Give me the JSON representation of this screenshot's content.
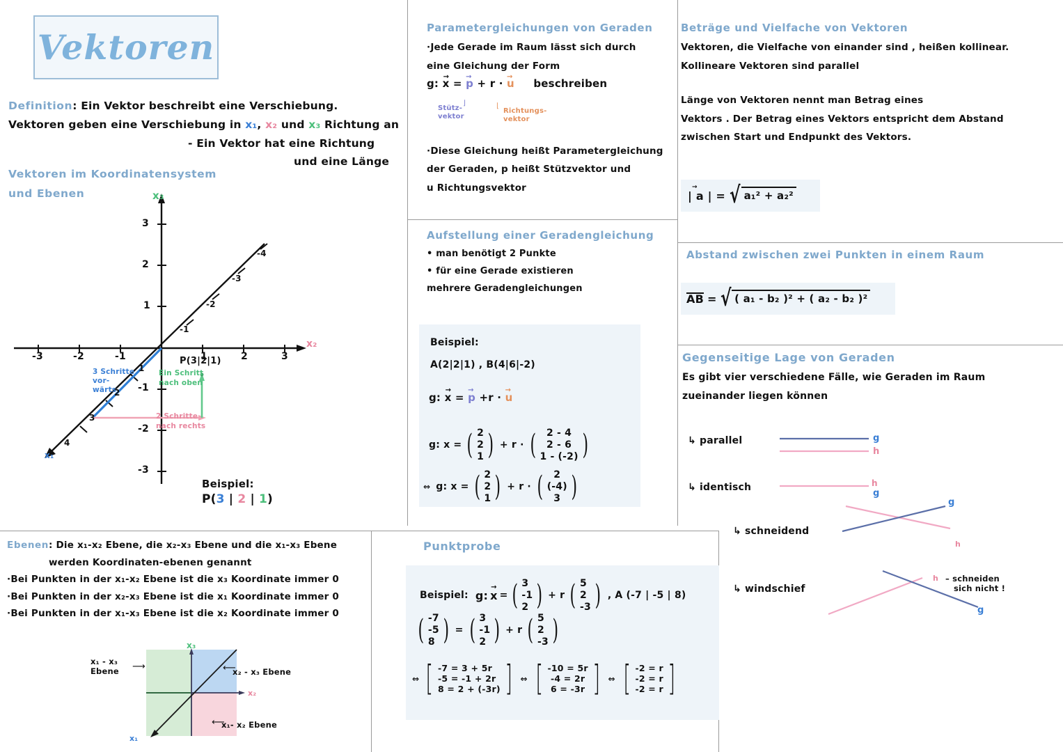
{
  "title": "Vektoren",
  "definition": {
    "label": "Definition",
    "l1a": ": Ein Vektor beschreibt eine Verschiebung.",
    "l2a": "Vektoren geben eine Verschiebung in ",
    "x1": "x₁",
    "comma": ", ",
    "x2": "x₂",
    "und": " und ",
    "x3": "x₃",
    "l2b": " Richtung an",
    "l3": "- Ein Vektor hat eine Richtung",
    "l4": "und eine Länge"
  },
  "coord_section": {
    "heading_l1": "Vektoren im Koordinatensystem",
    "heading_l2": "und Ebenen",
    "axis_x1": "x₁",
    "axis_x2": "x₂",
    "axis_x3": "x₃",
    "point_label": "P(3|2|1)",
    "note_blue_l1": "3 Schritte",
    "note_blue_l2": "vor-",
    "note_blue_l3": "wärts",
    "note_green_l1": "Ein Schritt",
    "note_green_l2": "nach oben",
    "note_pink_l1": "2 Schritte",
    "note_pink_l2": "nach rechts",
    "example_label": "Beispiel:",
    "example_point_open": "P(",
    "example_v1": "3",
    "example_sep1": " | ",
    "example_v2": "2",
    "example_sep2": " | ",
    "example_v3": "1",
    "example_point_close": ")",
    "x2_ticks": [
      "-3",
      "-2",
      "-1",
      "1",
      "2",
      "3"
    ],
    "x3_ticks": [
      "3",
      "2",
      "1",
      "-1",
      "-2",
      "-3"
    ],
    "x1_ticks": [
      "-1",
      "-2",
      "-3",
      "-4"
    ],
    "x1_pos_ticks": [
      "1",
      "2",
      "3",
      "4"
    ]
  },
  "ebenen": {
    "label": "Ebenen",
    "l1": ": Die x₁-x₂ Ebene, die x₂-x₃ Ebene und   die   x₁-x₃ Ebene",
    "l2": "werden Koordinaten-ebenen genannt",
    "l3": "·Bei Punkten in der   x₁-x₂ Ebene ist die x₃ Koordinate immer 0",
    "l4": "·Bei Punkten in der x₂-x₃ Ebene ist die x₁ Koordinate immer 0",
    "l5": "·Bei Punkten in der x₁-x₃ Ebene ist die x₂ Koordinate immer 0",
    "diagram": {
      "axis_x3": "x₃",
      "axis_x2": "x₂",
      "axis_x1": "x₁",
      "label_left_l1": "x₁ - x₃",
      "label_left_l2": "Ebene",
      "label_right": "x₂ - x₃  Ebene",
      "label_bottom": "x₁- x₂  Ebene",
      "color_green": "#d6ecd6",
      "color_blue": "#bcd7f2",
      "color_pink": "#f8d6dd"
    }
  },
  "param": {
    "heading": "Parametergleichungen von Geraden",
    "l1": "·Jede Gerade im Raum lässt sich durch",
    "l2": "eine Gleichung der Form",
    "eq_g": "g:",
    "eq_x": "x",
    "eq_eq": "=",
    "eq_p": "p",
    "eq_plus": "+ r ·",
    "eq_u": "u",
    "eq_tail": "beschreiben",
    "ann_stuetz_l1": "Stütz-",
    "ann_stuetz_l2": "vektor",
    "ann_richt_l1": "Richtungs-",
    "ann_richt_l2": "vektor",
    "l3": "·Diese Gleichung heißt Parametergleichung",
    "l4": "der Geraden, p heißt Stützvektor und",
    "l5": "u  Richtungsvektor"
  },
  "aufstellung": {
    "heading": "Aufstellung einer   Geradengleichung",
    "b1": "• man benötigt 2 Punkte",
    "b2": "• für eine  Gerade existieren",
    "b3": "mehrere Geradengleichungen",
    "example_label": "Beispiel:",
    "points": "A(2|2|1) , B(4|6|-2)",
    "eq1_g": "g:",
    "eq1_x": "x",
    "eq1_eq": "=",
    "eq1_p": "p",
    "eq1_plus": "+r ·",
    "eq1_u": "u",
    "eq2_label": "g: x =",
    "eq2_vec1": [
      "2",
      "2",
      "1"
    ],
    "eq2_op": "+ r ·",
    "eq2_vec2": [
      "2 - 4",
      "2 - 6",
      "1 - (-2)"
    ],
    "eq3_arrow": "⇔",
    "eq3_label": "g: x =",
    "eq3_vec1": [
      "2",
      "2",
      "1"
    ],
    "eq3_op": "+ r ·",
    "eq3_vec2": [
      "2",
      "(-4)",
      "3"
    ]
  },
  "betraege": {
    "heading": "Beträge und Vielfache von Vektoren",
    "l1": "Vektoren, die  Vielfache von  einander sind , heißen kollinear.",
    "l2": "Kollineare  Vektoren sind  parallel",
    "l3": "Länge von Vektoren nennt man   Betrag eines",
    "l4": "Vektors . Der Betrag eines Vektors  entspricht dem   Abstand",
    "l5": "zwischen  Start und Endpunkt  des Vektors.",
    "formula_lhs": "| a | =",
    "formula_rad": "a₁² + a₂²"
  },
  "abstand": {
    "heading": "Abstand zwischen zwei Punkten in einem Raum",
    "formula_lhs": "AB",
    "formula_eq": "=",
    "formula_rad": "( a₁ - b₂ )² + ( a₂ - b₂ )²"
  },
  "lage": {
    "heading": "Gegenseitige Lage von Geraden",
    "l1": "Es gibt vier verschiedene Fälle, wie Geraden im Raum",
    "l2": "zueinander  liegen können",
    "case1": "↳ parallel",
    "case1_g": "g",
    "case1_h": "h",
    "case2": "↳ identisch",
    "case2_h": "h",
    "case2_g": "g",
    "case3": "↳ schneidend",
    "case3_g": "g",
    "case3_h": "h",
    "case4": "↳ windschief",
    "case4_h": "h",
    "case4_g": "g",
    "case4_note_l1": "– schneiden",
    "case4_note_l2": "sich nicht !",
    "color_line_blue": "#5b6fa8",
    "color_line_pink": "#f1a9c4"
  },
  "punktprobe": {
    "heading": "Punktprobe",
    "example_label": "Beispiel:",
    "eq_g": "g:",
    "eq_x": "x",
    "eq_eq": "=",
    "vec_p": [
      "3",
      "-1",
      "2"
    ],
    "eq_plus": "+ r",
    "vec_u": [
      "5",
      "2",
      "-3"
    ],
    "point_a": ", A (-7 | -5 | 8)",
    "row2_vec_lhs": [
      "-7",
      "-5",
      "8"
    ],
    "row2_eq": "=",
    "row2_vec_p": [
      "3",
      "-1",
      "2"
    ],
    "row2_plus": "+ r",
    "row2_vec_u": [
      "5",
      "2",
      "-3"
    ],
    "arrow": "⇔",
    "sys1": [
      "-7 = 3 + 5r",
      "-5 = -1 + 2r",
      "8 = 2 + (-3r)"
    ],
    "sys2": [
      "-10 = 5r",
      "-4 = 2r",
      "6 = -3r"
    ],
    "sys3": [
      "-2 = r",
      "-2 = r",
      "-2 = r"
    ]
  }
}
